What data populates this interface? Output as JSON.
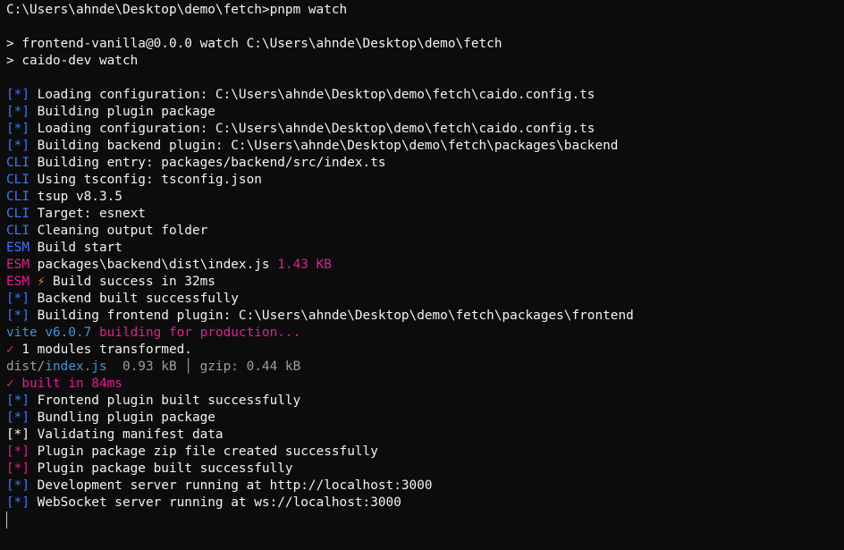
{
  "colors": {
    "default": "#f2f2f2",
    "blue": "#3b78ff",
    "cyan": "#3a96dd",
    "magenta": "#e11e96",
    "gray": "#9e9e9e",
    "white": "#ffffff",
    "bolt": "#ff8c1a"
  },
  "terminal": {
    "lines": [
      [
        {
          "t": "C:\\Users\\ahnde\\Desktop\\demo\\fetch>pnpm watch",
          "c": "default"
        }
      ],
      [],
      [
        {
          "t": "> frontend-vanilla@0.0.0 watch C:\\Users\\ahnde\\Desktop\\demo\\fetch",
          "c": "default"
        }
      ],
      [
        {
          "t": "> caido-dev watch",
          "c": "default"
        }
      ],
      [],
      [
        {
          "t": "[*]",
          "c": "blue"
        },
        {
          "t": " Loading configuration: C:\\Users\\ahnde\\Desktop\\demo\\fetch\\caido.config.ts",
          "c": "default"
        }
      ],
      [
        {
          "t": "[*]",
          "c": "blue"
        },
        {
          "t": " Building plugin package",
          "c": "default"
        }
      ],
      [
        {
          "t": "[*]",
          "c": "blue"
        },
        {
          "t": " Loading configuration: C:\\Users\\ahnde\\Desktop\\demo\\fetch\\caido.config.ts",
          "c": "default"
        }
      ],
      [
        {
          "t": "[*]",
          "c": "blue"
        },
        {
          "t": " Building backend plugin: C:\\Users\\ahnde\\Desktop\\demo\\fetch\\packages\\backend",
          "c": "default"
        }
      ],
      [
        {
          "t": "CLI",
          "c": "blue"
        },
        {
          "t": " Building entry: packages/backend/src/index.ts",
          "c": "default"
        }
      ],
      [
        {
          "t": "CLI",
          "c": "blue"
        },
        {
          "t": " Using tsconfig: tsconfig.json",
          "c": "default"
        }
      ],
      [
        {
          "t": "CLI",
          "c": "blue"
        },
        {
          "t": " tsup v8.3.5",
          "c": "default"
        }
      ],
      [
        {
          "t": "CLI",
          "c": "blue"
        },
        {
          "t": " Target: esnext",
          "c": "default"
        }
      ],
      [
        {
          "t": "CLI",
          "c": "blue"
        },
        {
          "t": " Cleaning output folder",
          "c": "default"
        }
      ],
      [
        {
          "t": "ESM",
          "c": "blue"
        },
        {
          "t": " Build start",
          "c": "default"
        }
      ],
      [
        {
          "t": "ESM",
          "c": "magenta"
        },
        {
          "t": " packages\\backend\\dist\\index.js ",
          "c": "default"
        },
        {
          "t": "1.43 KB",
          "c": "magenta"
        }
      ],
      [
        {
          "t": "ESM",
          "c": "magenta"
        },
        {
          "t": " ",
          "c": "default"
        },
        {
          "t": "⚡",
          "c": "bolt",
          "name": "lightning-icon"
        },
        {
          "t": " Build success in 32ms",
          "c": "default"
        }
      ],
      [
        {
          "t": "[*]",
          "c": "blue"
        },
        {
          "t": " Backend built successfully",
          "c": "default"
        }
      ],
      [
        {
          "t": "[*]",
          "c": "blue"
        },
        {
          "t": " Building frontend plugin: C:\\Users\\ahnde\\Desktop\\demo\\fetch\\packages\\frontend",
          "c": "default"
        }
      ],
      [
        {
          "t": "vite v6.0.7",
          "c": "cyan"
        },
        {
          "t": " ",
          "c": "default"
        },
        {
          "t": "building for production...",
          "c": "magenta"
        }
      ],
      [
        {
          "t": "✓",
          "c": "magenta",
          "name": "checkmark-icon"
        },
        {
          "t": " 1 modules transformed.",
          "c": "default"
        }
      ],
      [
        {
          "t": "dist/",
          "c": "gray"
        },
        {
          "t": "index.js",
          "c": "cyan"
        },
        {
          "t": "  0.93 kB │ gzip: 0.44 kB",
          "c": "gray"
        }
      ],
      [
        {
          "t": "✓",
          "c": "magenta",
          "name": "checkmark-icon"
        },
        {
          "t": " built in 84ms",
          "c": "magenta"
        }
      ],
      [
        {
          "t": "[*]",
          "c": "blue"
        },
        {
          "t": " Frontend plugin built successfully",
          "c": "default"
        }
      ],
      [
        {
          "t": "[*]",
          "c": "blue"
        },
        {
          "t": " Bundling plugin package",
          "c": "default"
        }
      ],
      [
        {
          "t": "[*]",
          "c": "white"
        },
        {
          "t": " Validating manifest data",
          "c": "default"
        }
      ],
      [
        {
          "t": "[*]",
          "c": "magenta"
        },
        {
          "t": " Plugin package zip file created successfully",
          "c": "default"
        }
      ],
      [
        {
          "t": "[*]",
          "c": "magenta"
        },
        {
          "t": " Plugin package built successfully",
          "c": "default"
        }
      ],
      [
        {
          "t": "[*]",
          "c": "blue"
        },
        {
          "t": " Development server running at http://localhost:3000",
          "c": "default"
        }
      ],
      [
        {
          "t": "[*]",
          "c": "blue"
        },
        {
          "t": " WebSocket server running at ws://localhost:3000",
          "c": "default"
        }
      ],
      [
        {
          "cursor": true
        }
      ]
    ]
  }
}
